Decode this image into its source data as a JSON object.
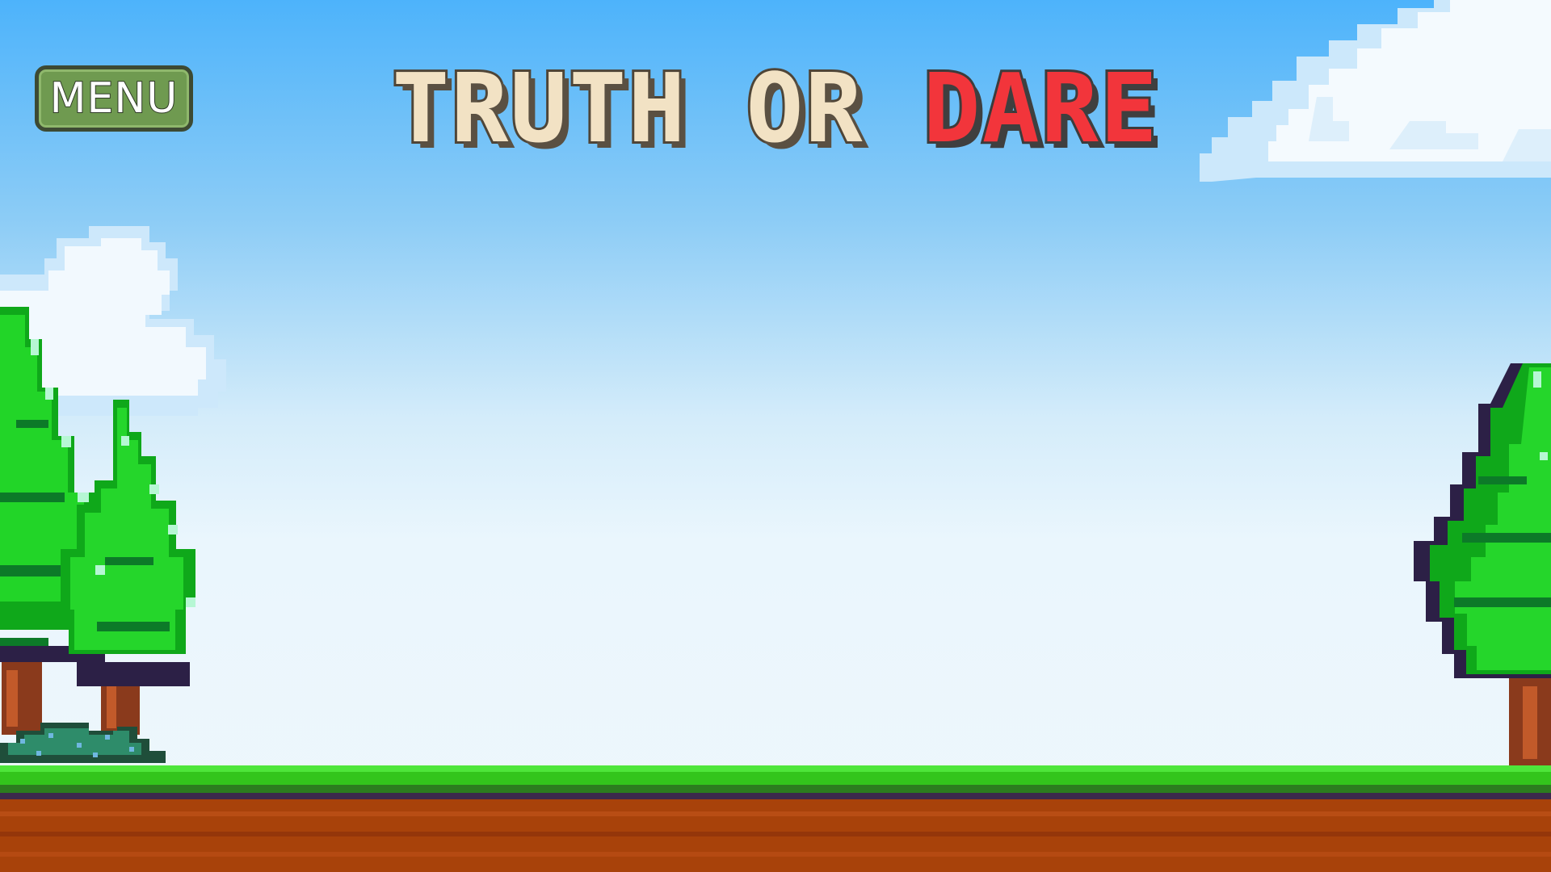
{
  "menu": {
    "label": "MENU"
  },
  "title": {
    "word_truth": "TRUTH",
    "word_or": "OR",
    "word_dare": "DARE",
    "color_truth": "#f2e2c4",
    "color_dare": "#f2353b"
  },
  "palette": {
    "sky_top": "#4db3fb",
    "sky_bottom": "#eef7fc",
    "grass": "#33c51c",
    "dirt": "#a8420a",
    "tree_green": "#19c41e",
    "menu_button": "#6f9a50"
  },
  "scene": {
    "icons": [
      "cloud-icon",
      "pine-tree-icon",
      "bush-icon",
      "grass-ground-tile"
    ]
  }
}
